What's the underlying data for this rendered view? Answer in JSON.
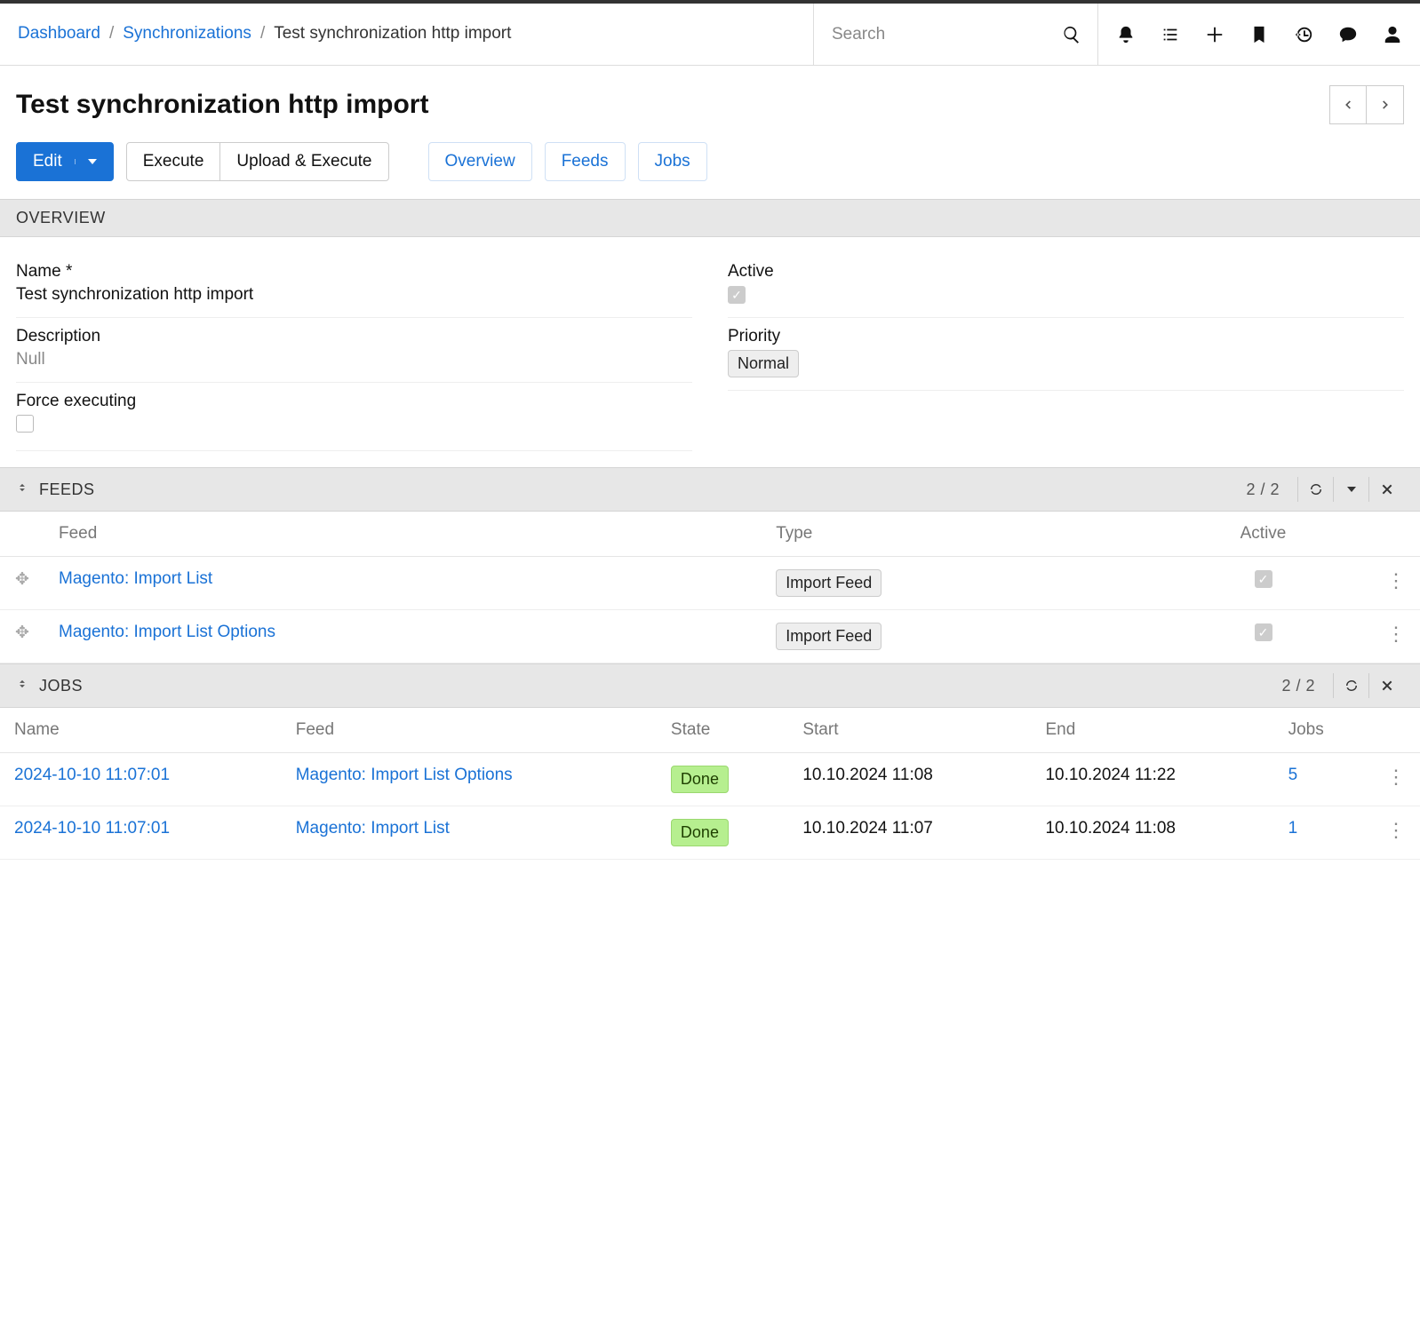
{
  "breadcrumbs": {
    "items": [
      {
        "label": "Dashboard"
      },
      {
        "label": "Synchronizations"
      },
      {
        "label": "Test synchronization http import"
      }
    ]
  },
  "search": {
    "placeholder": "Search"
  },
  "page_title": "Test synchronization http import",
  "actions": {
    "edit": "Edit",
    "execute": "Execute",
    "upload_execute": "Upload & Execute"
  },
  "tabs": {
    "overview": "Overview",
    "feeds": "Feeds",
    "jobs": "Jobs"
  },
  "overview": {
    "heading": "OVERVIEW",
    "fields": {
      "name_label": "Name *",
      "name_value": "Test synchronization http import",
      "description_label": "Description",
      "description_value": "Null",
      "force_label": "Force executing",
      "force_checked": false,
      "active_label": "Active",
      "active_checked": true,
      "priority_label": "Priority",
      "priority_value": "Normal"
    }
  },
  "feeds": {
    "heading": "FEEDS",
    "count": "2 / 2",
    "columns": {
      "feed": "Feed",
      "type": "Type",
      "active": "Active"
    },
    "rows": [
      {
        "feed": "Magento: Import List",
        "type": "Import Feed",
        "active": true
      },
      {
        "feed": "Magento: Import List Options",
        "type": "Import Feed",
        "active": true
      }
    ]
  },
  "jobs": {
    "heading": "JOBS",
    "count": "2 / 2",
    "columns": {
      "name": "Name",
      "feed": "Feed",
      "state": "State",
      "start": "Start",
      "end": "End",
      "jobs": "Jobs"
    },
    "rows": [
      {
        "name": "2024-10-10 11:07:01",
        "feed": "Magento: Import List Options",
        "state": "Done",
        "start": "10.10.2024 11:08",
        "end": "10.10.2024 11:22",
        "jobs": "5"
      },
      {
        "name": "2024-10-10 11:07:01",
        "feed": "Magento: Import List",
        "state": "Done",
        "start": "10.10.2024 11:07",
        "end": "10.10.2024 11:08",
        "jobs": "1"
      }
    ]
  }
}
